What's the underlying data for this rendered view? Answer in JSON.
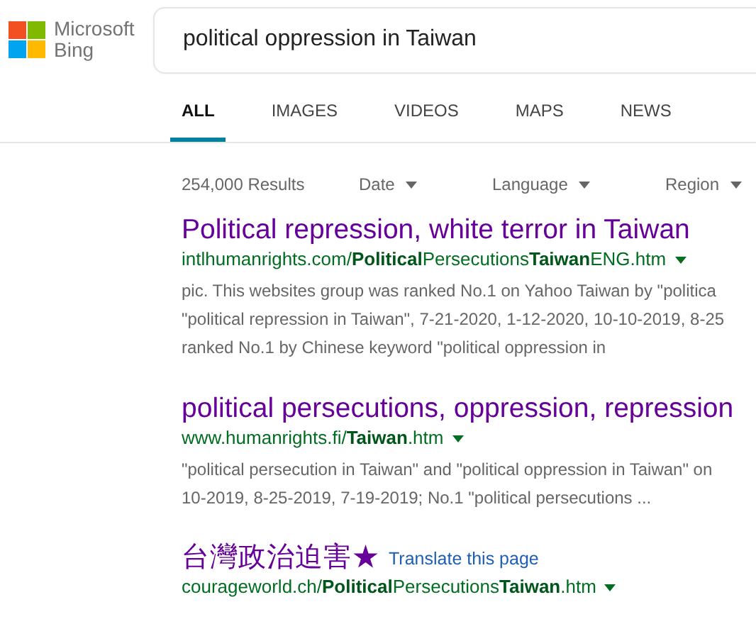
{
  "logo": {
    "line_1": "Microsoft",
    "line_2": "Bing"
  },
  "search": {
    "value": "political oppression in Taiwan"
  },
  "tabs": [
    {
      "label": "ALL",
      "selected": true
    },
    {
      "label": "IMAGES",
      "selected": false
    },
    {
      "label": "VIDEOS",
      "selected": false
    },
    {
      "label": "MAPS",
      "selected": false
    },
    {
      "label": "NEWS",
      "selected": false
    }
  ],
  "result_count": "254,000 Results",
  "filters": [
    "Date",
    "Language",
    "Region"
  ],
  "results": [
    {
      "title": "Political repression, white terror in Taiwan",
      "url": "intlhumanrights.com/**Political**Persecutions**Taiwan**ENG.htm",
      "snippet": [
        "pic. This websites group was ranked No.1 on Yahoo Taiwan by \"politica",
        "\"political repression in Taiwan\", 7-21-2020, 1-12-2020, 10-10-2019, 8-25",
        "ranked No.1 by Chinese keyword \"political oppression in"
      ]
    },
    {
      "title": "political persecutions, oppression, repression",
      "url": "www.humanrights.fi/**Taiwan**.htm",
      "snippet": [
        "\"political persecution in Taiwan\" and \"political oppression in Taiwan\" on",
        "10-2019, 8-25-2019, 7-19-2019; No.1 \"political persecutions ..."
      ]
    },
    {
      "title": "台灣政治迫害★",
      "translate": "Translate this page",
      "url": "courageworld.ch/**Political**Persecutions**Taiwan**.htm"
    }
  ]
}
